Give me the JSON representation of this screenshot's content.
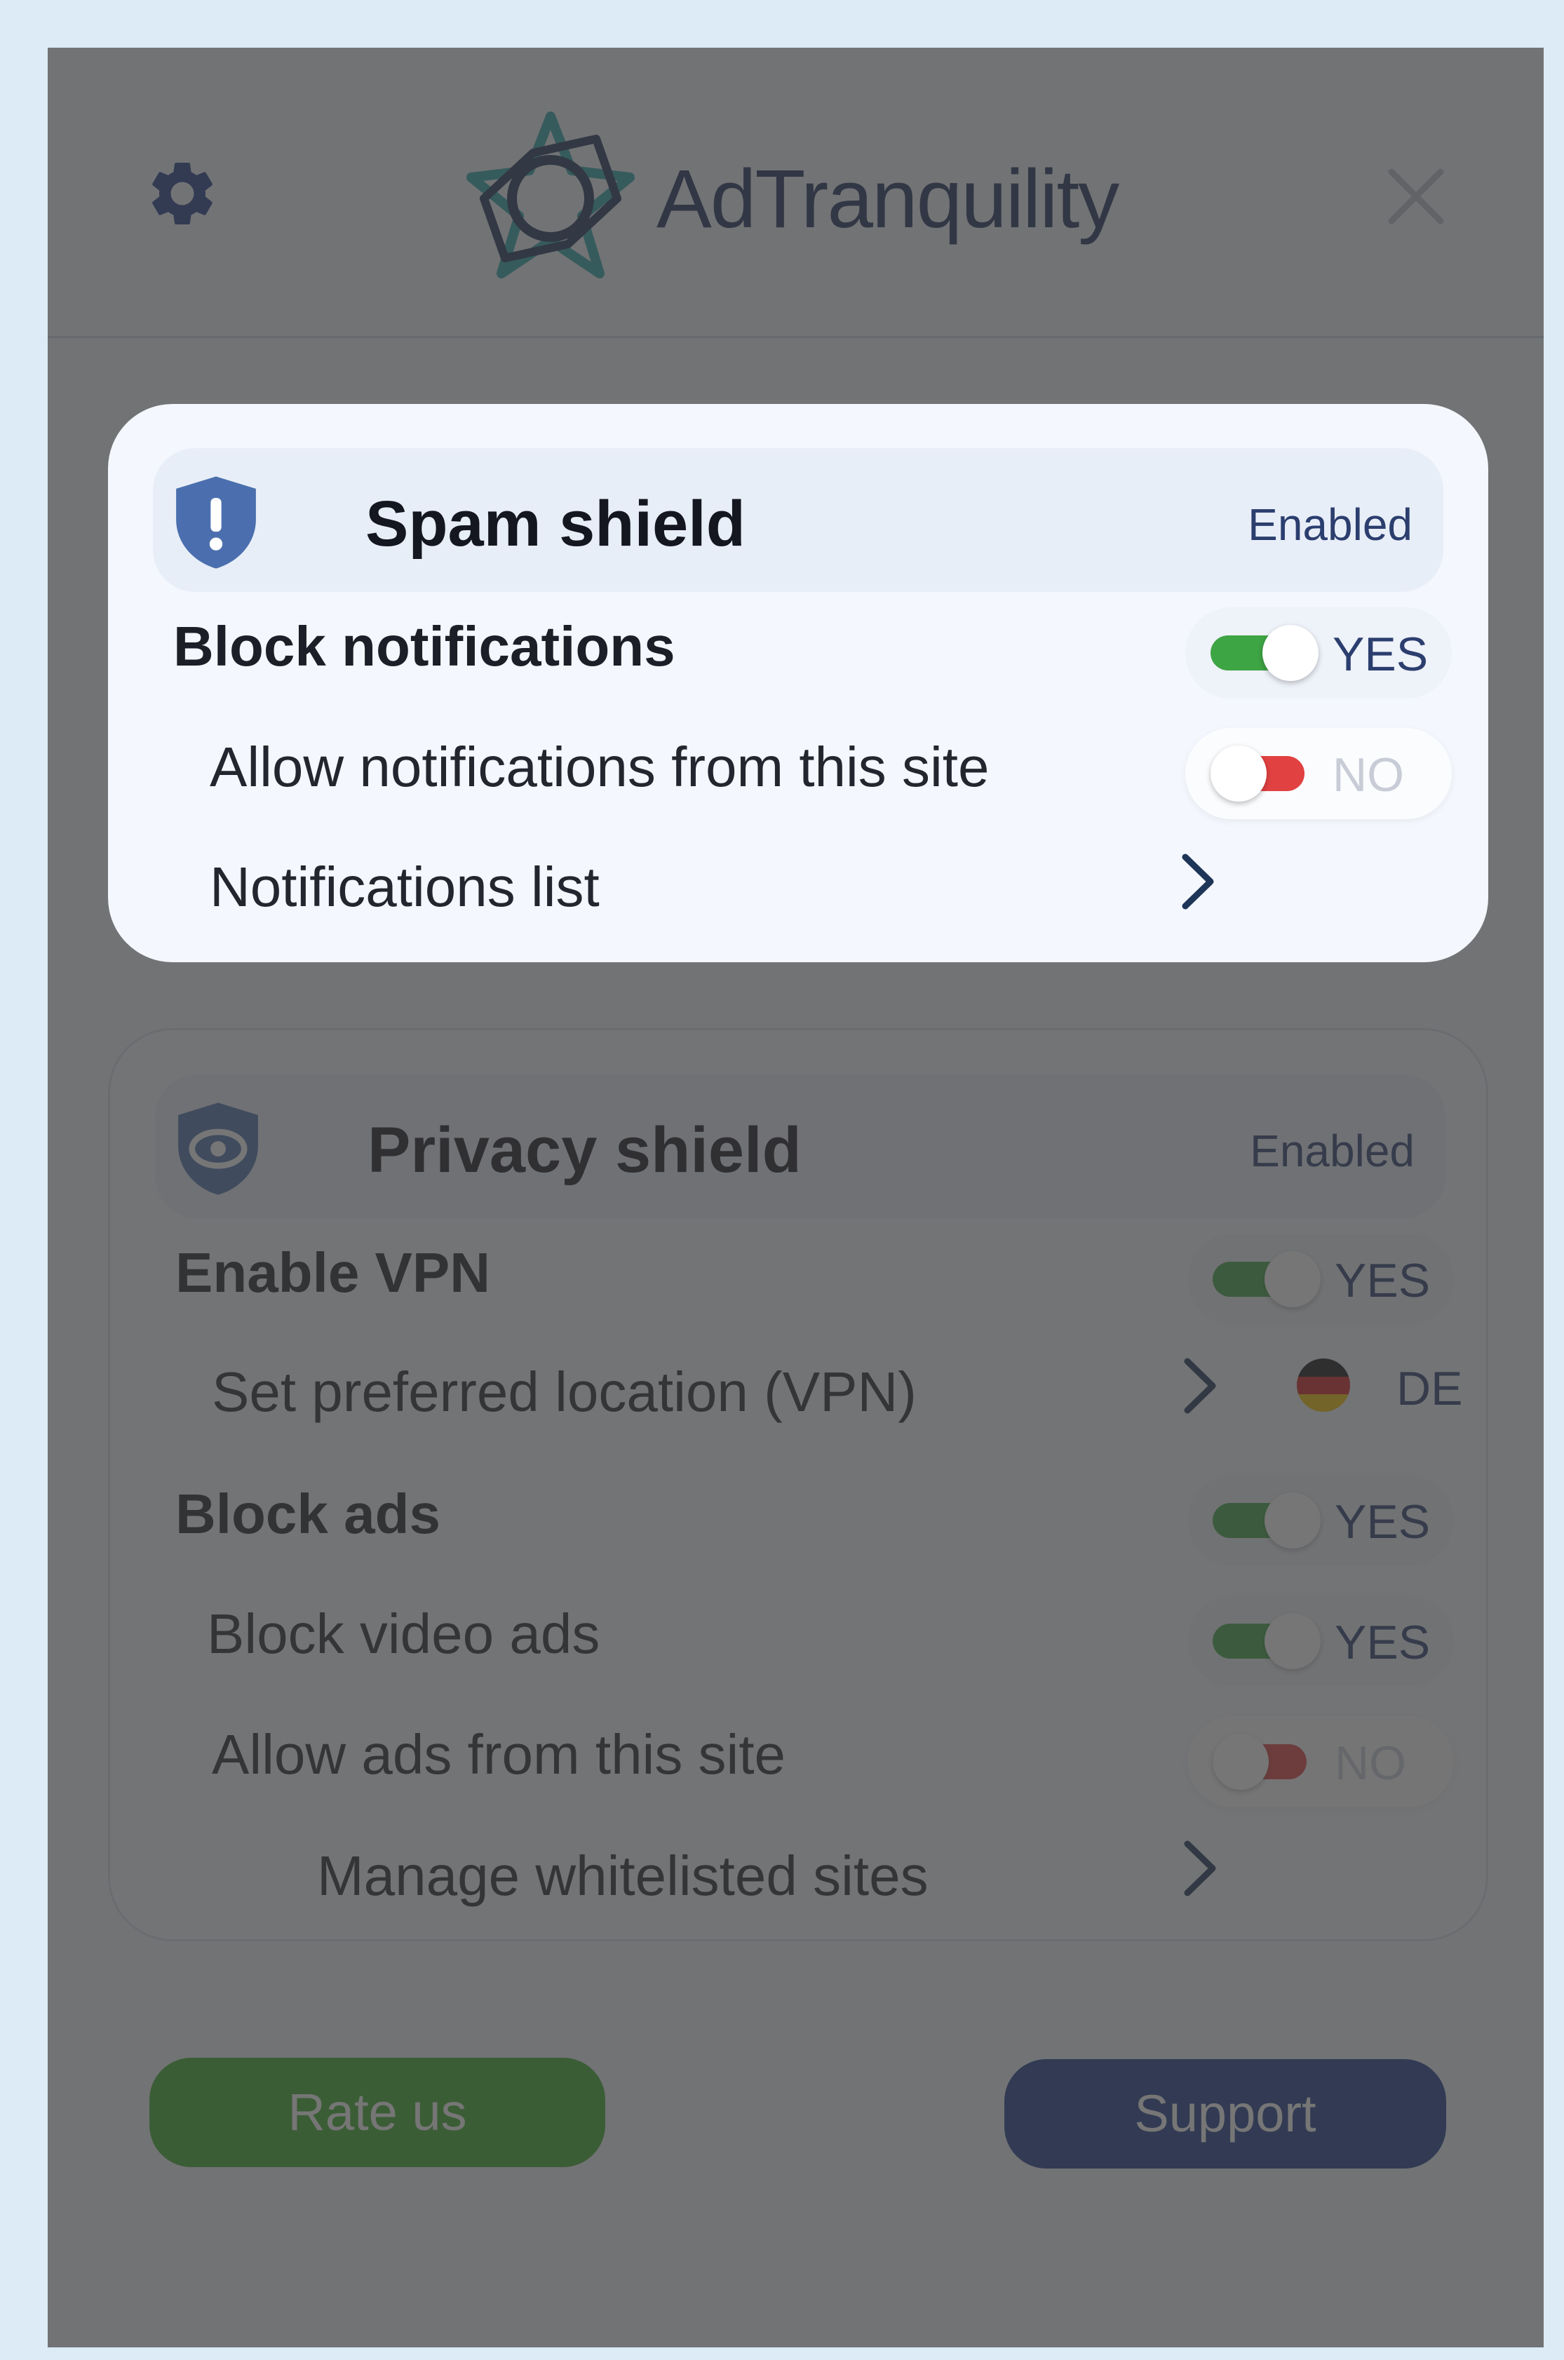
{
  "header": {
    "brand_name": "AdTranquility",
    "settings_icon": "gear-icon",
    "close_icon": "close-icon"
  },
  "spam_shield": {
    "title": "Spam shield",
    "status": "Enabled",
    "icon": "shield-exclamation-icon",
    "block_notifications": {
      "label": "Block notifications",
      "toggle": "YES"
    },
    "allow_notifications": {
      "label": "Allow notifications from this site",
      "toggle": "NO"
    },
    "notifications_list": {
      "label": "Notifications list"
    }
  },
  "privacy_shield": {
    "title": "Privacy shield",
    "status": "Enabled",
    "icon": "shield-eye-icon",
    "enable_vpn": {
      "label": "Enable VPN",
      "toggle": "YES"
    },
    "preferred_location": {
      "label": "Set preferred location (VPN)",
      "country_code": "DE",
      "flag": "germany-flag"
    },
    "block_ads": {
      "label": "Block ads",
      "toggle": "YES"
    },
    "block_video_ads": {
      "label": "Block video ads",
      "toggle": "YES"
    },
    "allow_ads": {
      "label": "Allow ads from this site",
      "toggle": "NO"
    },
    "manage_whitelist": {
      "label": "Manage whitelisted sites"
    }
  },
  "footer": {
    "rate_label": "Rate us",
    "support_label": "Support"
  },
  "colors": {
    "toggle_on": "#3ea544",
    "toggle_off": "#e14141",
    "rate_button": "#3aab2a",
    "support_button": "#1c3a8a",
    "brand_teal": "#2aa3a8",
    "brand_navy": "#1d3557"
  }
}
